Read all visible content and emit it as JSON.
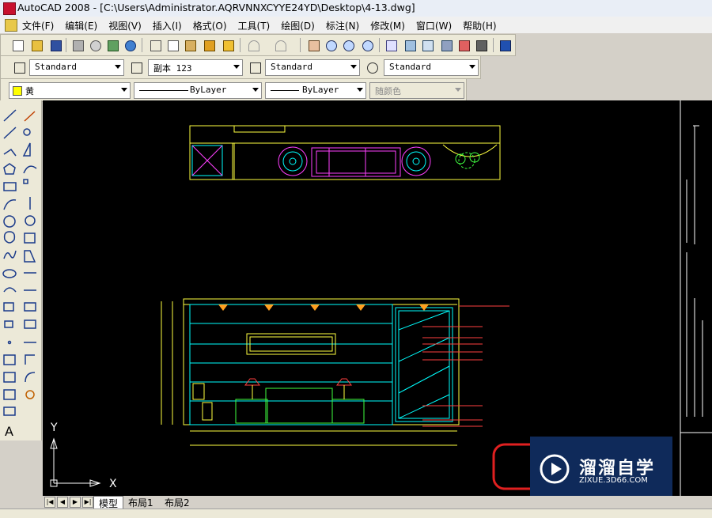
{
  "window": {
    "title": "AutoCAD 2008 - [C:\\Users\\Administrator.AQRVNNXCYYE24YD\\Desktop\\4-13.dwg]"
  },
  "menu": {
    "items": [
      "文件(F)",
      "编辑(E)",
      "视图(V)",
      "插入(I)",
      "格式(O)",
      "工具(T)",
      "绘图(D)",
      "标注(N)",
      "修改(M)",
      "窗口(W)",
      "帮助(H)"
    ]
  },
  "styles_toolbar": {
    "text_style": "Standard",
    "dim_style": "副本 123",
    "table_style": "Standard",
    "multileader_style": "Standard"
  },
  "properties_toolbar": {
    "layer": "黄",
    "linetype": "ByLayer",
    "lineweight": "ByLayer",
    "plotstyle": "随颜色"
  },
  "colors": {
    "layer_swatch": "#ffff00",
    "canvas": "#000000"
  },
  "canvas": {
    "axis_x_label": "X",
    "axis_y_label": "Y"
  },
  "tabs": [
    {
      "label": "模型"
    },
    {
      "label": "布局1"
    },
    {
      "label": "布局2"
    }
  ],
  "watermark": {
    "title": "溜溜自学",
    "subtitle": "ZIXUE.3D66.COM"
  }
}
